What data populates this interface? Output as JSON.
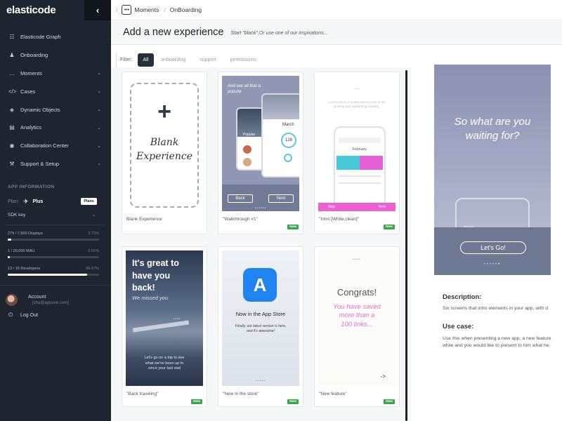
{
  "sidebar": {
    "logo": "elasticode",
    "collapse_icon": "chevron-left-icon",
    "nav": [
      {
        "label": "Elasticode Graph",
        "icon": "graph-icon",
        "chevron": false
      },
      {
        "label": "Onboarding",
        "icon": "person-icon",
        "chevron": false
      },
      {
        "label": "Moments",
        "icon": "dots-icon",
        "chevron": true
      },
      {
        "label": "Cases",
        "icon": "code-icon",
        "chevron": true
      },
      {
        "label": "Dynamic Objects",
        "icon": "cube-icon",
        "chevron": true
      },
      {
        "label": "Analytics",
        "icon": "chart-icon",
        "chevron": true
      },
      {
        "label": "Collaboration Center",
        "icon": "globe-icon",
        "chevron": true
      },
      {
        "label": "Support & Setup",
        "icon": "wrench-icon",
        "chevron": true
      }
    ],
    "app_info_title": "APP INFORMATION",
    "plan_label": "Plan:",
    "plan_name": "Plus",
    "plans_button": "Plans",
    "sdk_label": "SDK key",
    "usage": [
      {
        "label": "279 / 7,500 Displays",
        "pct_text": "3.72%",
        "fraction": 0.0372
      },
      {
        "label": "1 / 20,000 MAU",
        "pct_text": "0.01%",
        "fraction": 0.0001
      },
      {
        "label": "13 / 15 Developers",
        "pct_text": "86.67%",
        "fraction": 0.8667
      }
    ],
    "account_label": "Account",
    "account_email": "[sha@appove.com]",
    "logout_label": "Log Out"
  },
  "topbar": {
    "crumb1": "Moments",
    "crumb2": "OnBoarding"
  },
  "title": {
    "heading": "Add a new experience",
    "subtitle": "Start \"blank\",Or use one of our inspirations..."
  },
  "filter": {
    "label": "Filter:",
    "options": [
      "All",
      "onboarding",
      "support",
      "permissions"
    ]
  },
  "cards": [
    {
      "caption": "Blank Experience",
      "new": false,
      "blank_line1": "Blank",
      "blank_line2": "Experience"
    },
    {
      "caption": "\"Walkthrough #1\"",
      "new": true,
      "heading": "And see all that is popular",
      "back": "Back",
      "next": "Next",
      "popular": "Popular",
      "month": "March",
      "num": "128"
    },
    {
      "caption": "\"Intro [White,clean]\"",
      "new": true,
      "body": "Lorem ipsum is simply dummy text of the printing and typesetting industry.",
      "month": "February",
      "skip": "Skip",
      "next": "Next"
    },
    {
      "caption": "\"Back traveling\"",
      "new": true,
      "title1": "It's great to",
      "title2": "have you",
      "title3": "back!",
      "sub": "We missed you",
      "body1": "Let's go on a trip to see",
      "body2": "what we've been up to",
      "body3": "since your last visit"
    },
    {
      "caption": "\"New in the store\"",
      "new": true,
      "title": "Now in the App Store",
      "body1": "Finally, our latest version is here,",
      "body2": "and it's awesome!"
    },
    {
      "caption": "\"New feature\"",
      "new": true,
      "title": "Congrats!",
      "sub1": "You have saved",
      "sub2": "more than a",
      "sub3": "100 links...",
      "arrow": "->"
    }
  ],
  "new_badge": "New",
  "preview": {
    "title1": "So what are you",
    "title2": "waiting for?",
    "phone_label": "Groups",
    "button": "Let's Go!",
    "description_label": "Description:",
    "description": "Six screens that intro elements in your app, with d",
    "usecase_label": "Use case:",
    "usecase_line1": "Use this when presenting a new app, a new feature",
    "usecase_line2": "while and you would like to present to him what he"
  },
  "colors": {
    "sidebar_bg": "#1e2430",
    "accent_green": "#3aa54a",
    "accent_pink": "#ef5fd2",
    "preview_purple": "#8a91b2"
  }
}
